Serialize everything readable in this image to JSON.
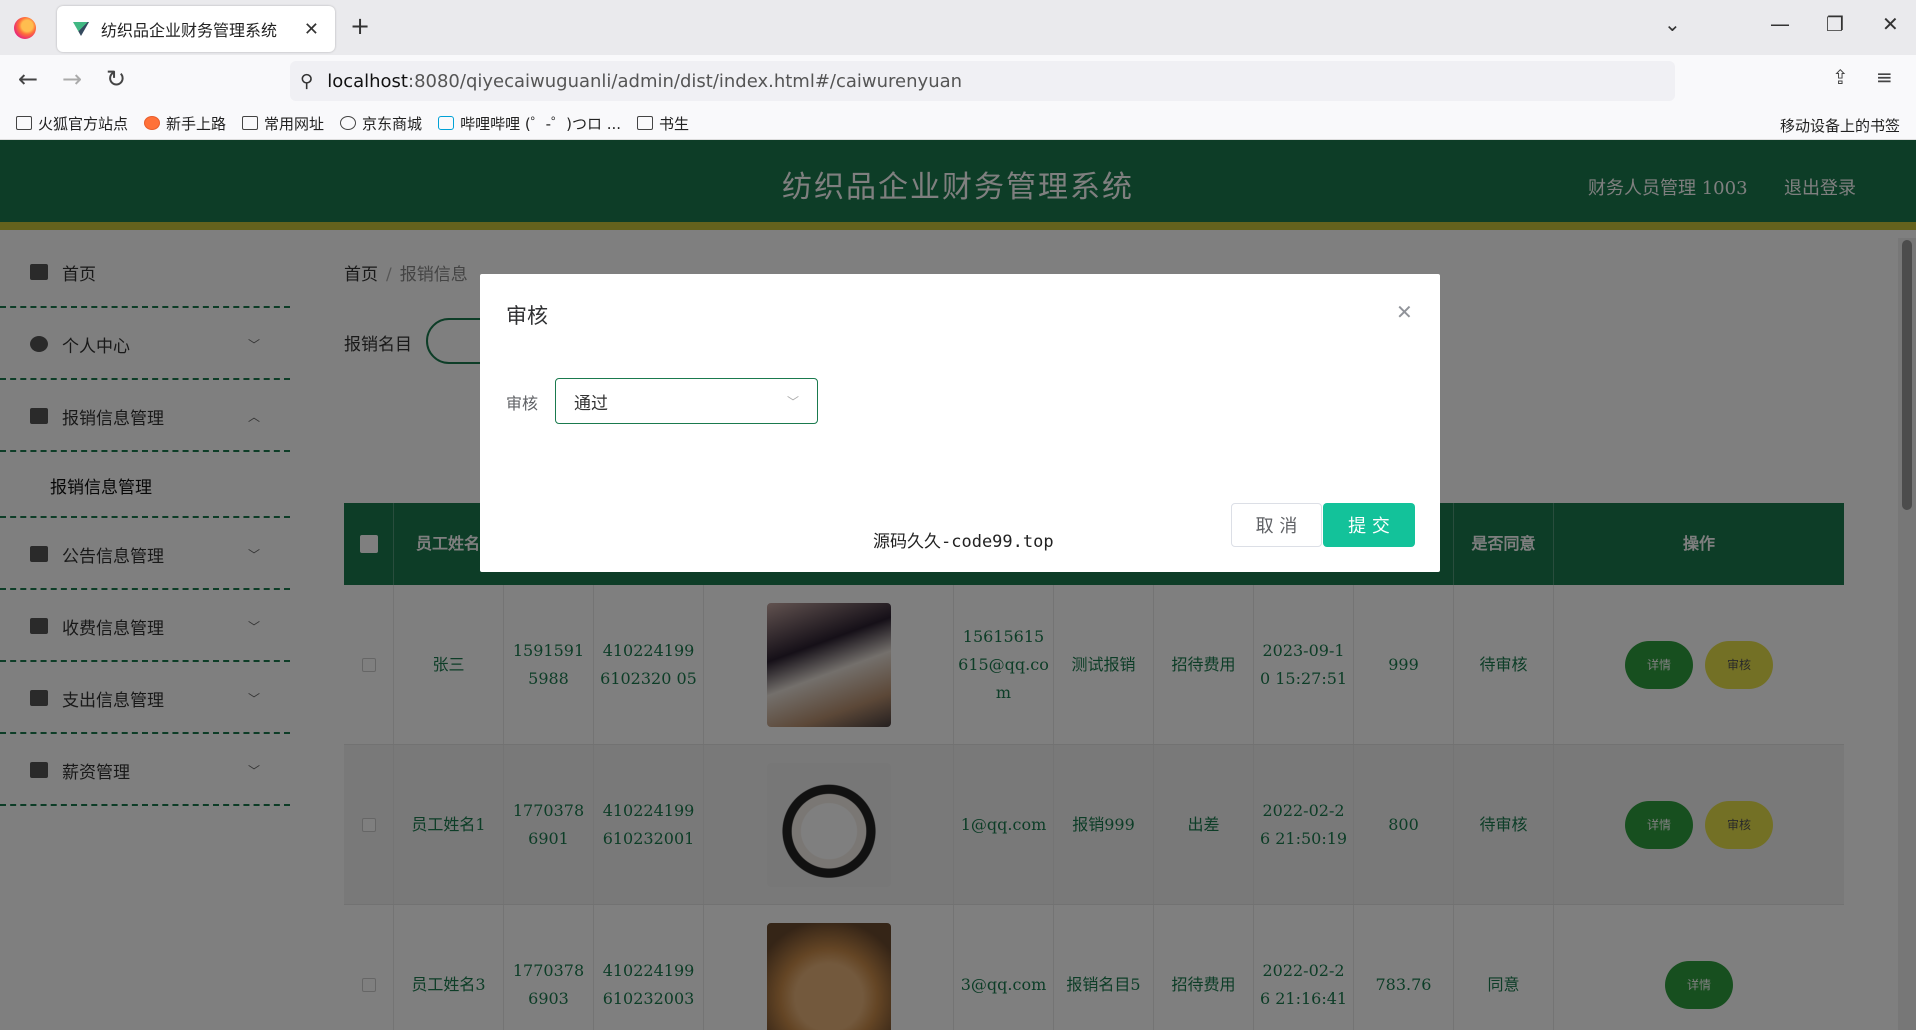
{
  "browser": {
    "tab_title": "纺织品企业财务管理系统",
    "tab_close": "✕",
    "new_tab": "+",
    "url_host": "localhost",
    "url_path": ":8080/qiyecaiwuguanli/admin/dist/index.html#/caiwurenyuan",
    "bookmarks": [
      "火狐官方站点",
      "新手上路",
      "常用网址",
      "京东商城",
      "哔哩哔哩 (゜-゜)つロ ...",
      "书生"
    ],
    "mobile_bookmarks": "移动设备上的书签"
  },
  "header": {
    "title": "纺织品企业财务管理系统",
    "user": "财务人员管理 1003",
    "logout": "退出登录"
  },
  "sidebar": {
    "items": [
      {
        "label": "首页",
        "icon": "home-icon"
      },
      {
        "label": "个人中心",
        "icon": "user-icon"
      },
      {
        "label": "报销信息管理",
        "icon": "report-icon"
      },
      {
        "label": "报销信息管理"
      },
      {
        "label": "公告信息管理",
        "icon": "notice-icon"
      },
      {
        "label": "收费信息管理",
        "icon": "fee-icon"
      },
      {
        "label": "支出信息管理",
        "icon": "send-icon"
      },
      {
        "label": "薪资管理",
        "icon": "salary-icon"
      }
    ]
  },
  "breadcrumb": {
    "home": "首页",
    "sep": "/",
    "current": "报销信息"
  },
  "search": {
    "label": "报销名目"
  },
  "table": {
    "headers": [
      "员工姓名",
      "是否同意",
      "操作"
    ],
    "rows": [
      {
        "name": "张三",
        "phone": "15915915988",
        "id": "4102241996102320 05",
        "email": "15615615615@qq.com",
        "item": "测试报销",
        "type": "招待费用",
        "time": "2023-09-10 15:27:51",
        "amount": "999",
        "status": "待审核"
      },
      {
        "name": "员工姓名1",
        "phone": "17703786901",
        "id": "410224199610232001",
        "email": "1@qq.com",
        "item": "报销999",
        "type": "出差",
        "time": "2022-02-26 21:50:19",
        "amount": "800",
        "status": "待审核"
      },
      {
        "name": "员工姓名3",
        "phone": "17703786903",
        "id": "410224199610232003",
        "email": "3@qq.com",
        "item": "报销名目5",
        "type": "招待费用",
        "time": "2022-02-26 21:16:41",
        "amount": "783.76",
        "status": "同意"
      }
    ],
    "btn_detail": "详情",
    "btn_audit": "审核"
  },
  "dialog": {
    "title": "审核",
    "close": "✕",
    "field_label": "审核",
    "select_value": "通过",
    "footer_text": "源码久久-code99.top",
    "cancel": "取 消",
    "submit": "提 交"
  },
  "colors": {
    "primary": "#1a7a4e",
    "accent": "#c8c43a",
    "submit": "#13c29a"
  }
}
